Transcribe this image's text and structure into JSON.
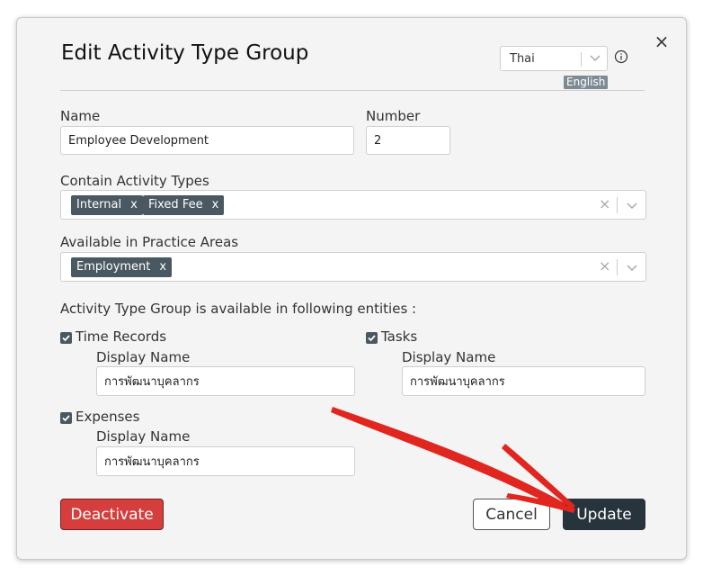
{
  "dialog": {
    "title": "Edit Activity Type Group",
    "close_symbol": "×",
    "language": {
      "selected": "Thai",
      "badge": "English"
    }
  },
  "form": {
    "name_label": "Name",
    "name_value": "Employee Development",
    "number_label": "Number",
    "number_value": "2",
    "activity_types_label": "Contain Activity Types",
    "activity_types": [
      "Internal",
      "Fixed Fee"
    ],
    "practice_areas_label": "Available in Practice Areas",
    "practice_areas": [
      "Employment"
    ],
    "entities_label": "Activity Type Group is available in following entities :",
    "entities": [
      {
        "label": "Time Records",
        "checked": true,
        "display_name_label": "Display Name",
        "display_name_value": "การพัฒนาบุคลากร"
      },
      {
        "label": "Tasks",
        "checked": true,
        "display_name_label": "Display Name",
        "display_name_value": "การพัฒนาบุคลากร"
      },
      {
        "label": "Expenses",
        "checked": true,
        "display_name_label": "Display Name",
        "display_name_value": "การพัฒนาบุคลากร"
      }
    ],
    "tag_remove_symbol": "x",
    "clear_symbol": "×"
  },
  "footer": {
    "deactivate_label": "Deactivate",
    "cancel_label": "Cancel",
    "update_label": "Update"
  },
  "colors": {
    "tag_bg": "#4a5961",
    "deactivate_bg": "#d63d3d",
    "update_bg": "#27343c",
    "annotation_arrow": "#e0261f"
  },
  "icons": {
    "close": "close-icon",
    "chevron": "chevron-down-icon",
    "info": "info-icon",
    "checkbox": "checkbox-checked-icon",
    "annotation": "annotation-arrow-icon"
  }
}
